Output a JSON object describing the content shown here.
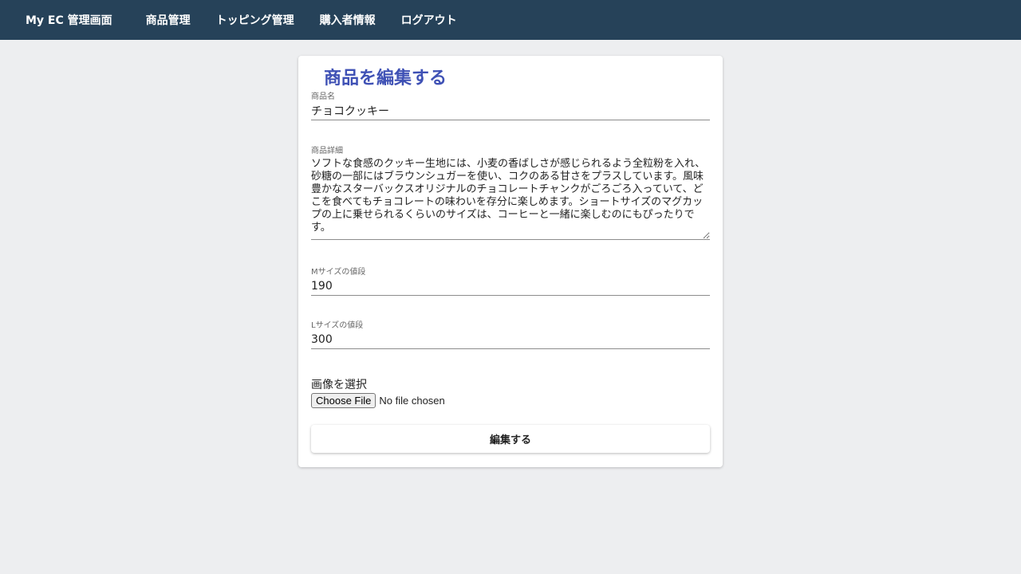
{
  "navbar": {
    "brand": "My EC 管理画面",
    "links": [
      "商品管理",
      "トッピング管理",
      "購入者情報",
      "ログアウト"
    ],
    "background": "#264259"
  },
  "form": {
    "title": "商品を編集する",
    "title_color": "#3f51b5",
    "name": {
      "label": "商品名",
      "value": "チョコクッキー"
    },
    "description": {
      "label": "商品詳細",
      "value": "ソフトな食感のクッキー生地には、小麦の香ばしさが感じられるよう全粒粉を入れ、砂糖の一部にはブラウンシュガーを使い、コクのある甘さをプラスしています。風味豊かなスターバックスオリジナルのチョコレートチャンクがごろごろ入っていて、どこを食べてもチョコレートの味わいを存分に楽しめます。ショートサイズのマグカップの上に乗せられるくらいのサイズは、コーヒーと一緒に楽しむのにもぴったりです。"
    },
    "price_m": {
      "label": "Mサイズの値段",
      "value": "190"
    },
    "price_l": {
      "label": "Lサイズの値段",
      "value": "300"
    },
    "image": {
      "label": "画像を選択",
      "button": "Choose File",
      "status": "No file chosen"
    },
    "submit_label": "編集する"
  }
}
